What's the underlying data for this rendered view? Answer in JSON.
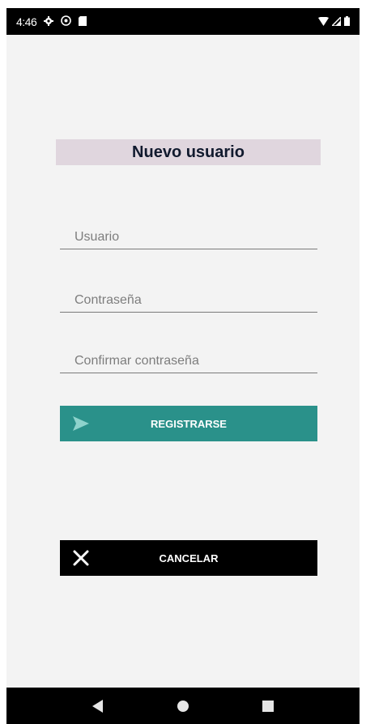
{
  "status_bar": {
    "time": "4:46",
    "icons": [
      "gear-icon",
      "vpn-icon",
      "sd-card-icon",
      "wifi-icon",
      "signal-icon",
      "battery-icon"
    ]
  },
  "form": {
    "title": "Nuevo usuario",
    "username_placeholder": "Usuario",
    "password_placeholder": "Contraseña",
    "confirm_password_placeholder": "Confirmar contraseña",
    "register_label": "REGISTRARSE",
    "cancel_label": "CANCELAR"
  },
  "colors": {
    "title_bg": "#e0d6de",
    "register_bg": "#2a918a",
    "cancel_bg": "#000000",
    "screen_bg": "#f3f3f3"
  },
  "nav_bar": {
    "icons": [
      "back-icon",
      "home-icon",
      "recents-icon"
    ]
  }
}
